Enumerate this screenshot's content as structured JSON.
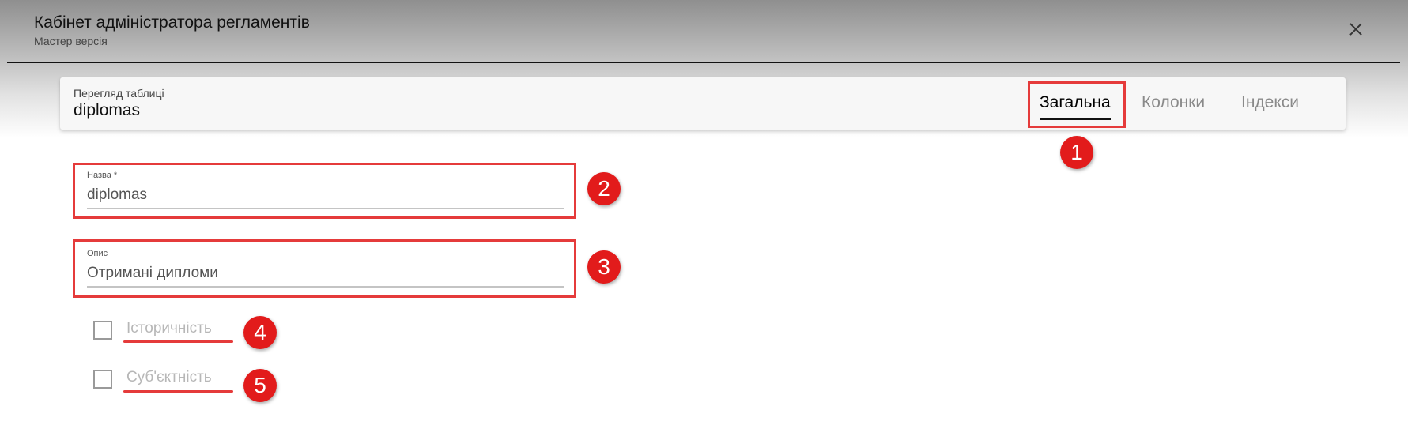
{
  "app": {
    "title": "Кабінет адміністратора регламентів",
    "subtitle": "Мастер версія"
  },
  "card": {
    "label": "Перегляд таблиці",
    "table_name": "diplomas",
    "tabs": [
      {
        "label": "Загальна",
        "active": true
      },
      {
        "label": "Колонки",
        "active": false
      },
      {
        "label": "Індекси",
        "active": false
      }
    ]
  },
  "form": {
    "name": {
      "label": "Назва *",
      "value": "diplomas"
    },
    "description": {
      "label": "Опис",
      "value": "Отримані дипломи"
    },
    "historicity": {
      "label": "Історичність",
      "checked": false
    },
    "subject": {
      "label": "Суб'єктність",
      "checked": false
    }
  },
  "markers": [
    "1",
    "2",
    "3",
    "4",
    "5"
  ],
  "colors": {
    "highlight": "#e53b3b",
    "marker": "#e21b1b",
    "active_tab": "#000000",
    "inactive_tab": "#8a8a8a"
  },
  "icons": {
    "close": "close-icon"
  }
}
